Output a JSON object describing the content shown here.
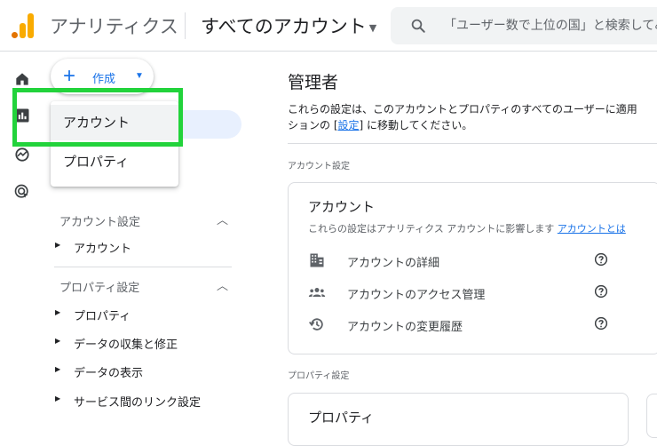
{
  "header": {
    "app_title": "アナリティクス",
    "account_selector": "すべてのアカウント",
    "search_placeholder": "「ユーザー数で上位の国」と検索してみてください"
  },
  "create_menu": {
    "button_label": "作成",
    "items": [
      "アカウント",
      "プロパティ"
    ]
  },
  "nav": {
    "account_section": {
      "title": "アカウント設定",
      "items": [
        "アカウント"
      ]
    },
    "property_section": {
      "title": "プロパティ設定",
      "items": [
        "プロパティ",
        "データの収集と修正",
        "データの表示",
        "サービス間のリンク設定"
      ]
    }
  },
  "main": {
    "title": "管理者",
    "desc_line1": "これらの設定は、このアカウントとプロパティのすべてのユーザーに適用",
    "desc_line2_pre": "ションの [",
    "desc_link": "設定",
    "desc_line2_post": "] に移動してください。",
    "account_caption": "アカウント設定",
    "account_card": {
      "title": "アカウント",
      "subtitle": "これらの設定はアナリティクス アカウントに影響します",
      "subtitle_link": "アカウントとは",
      "rows": [
        "アカウントの詳細",
        "アカウントのアクセス管理",
        "アカウントの変更履歴"
      ]
    },
    "property_caption": "プロパティ設定",
    "property_card": {
      "title": "プロパティ"
    }
  },
  "colors": {
    "accent": "#1a73e8",
    "highlight": "#22d33b",
    "logo_orange": "#f9ab00"
  }
}
